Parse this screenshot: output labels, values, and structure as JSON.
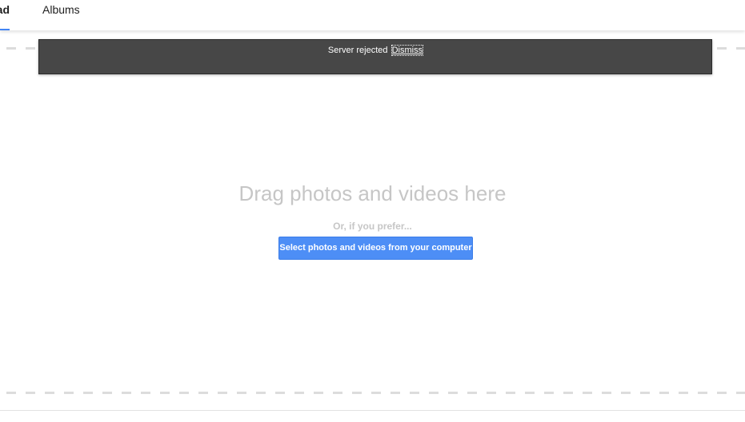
{
  "tabs": [
    {
      "label": "ad",
      "active": true
    },
    {
      "label": "Albums",
      "active": false
    }
  ],
  "snackbar": {
    "message": "Server rejected",
    "action": "Dismiss"
  },
  "dropzone": {
    "title": "Drag photos and videos here",
    "subtitle": "Or, if you prefer...",
    "button_label": "Select photos and videos from your computer"
  },
  "colors": {
    "accent": "#4285f4",
    "button": "#4d8ef6",
    "snackbar_bg": "#474747",
    "muted_text": "#c6c6c6"
  }
}
